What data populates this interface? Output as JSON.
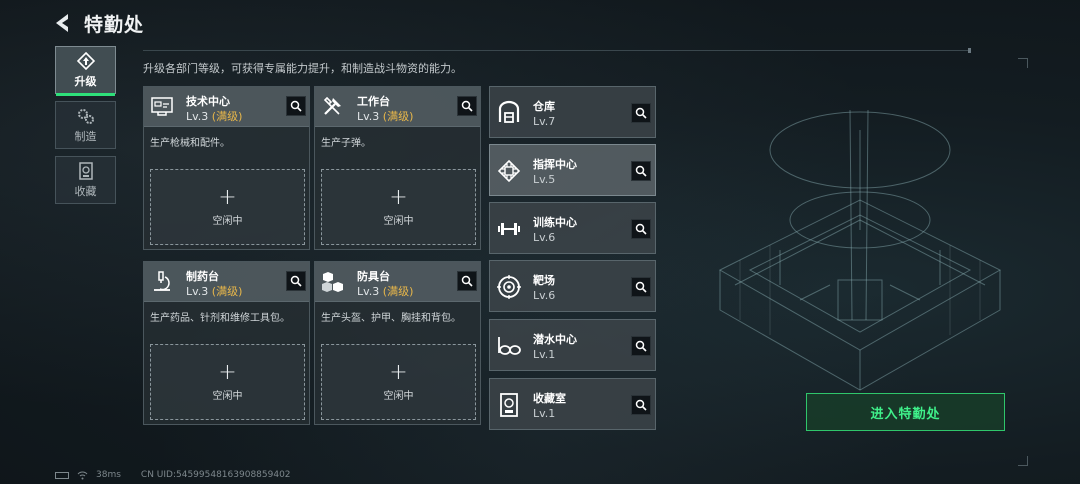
{
  "header": {
    "title": "特勤处"
  },
  "description": "升级各部门等级，可获得专属能力提升，和制造战斗物资的能力。",
  "side_tabs": [
    {
      "label": "升级",
      "icon": "upgrade-icon",
      "active": true
    },
    {
      "label": "制造",
      "icon": "gears-icon",
      "active": false
    },
    {
      "label": "收藏",
      "icon": "collection-icon",
      "active": false
    }
  ],
  "cards": [
    {
      "name": "技术中心",
      "level": "Lv.3",
      "max": "(满级)",
      "desc": "生产枪械和配件。",
      "plus": "+",
      "idle": "空闲中",
      "icon": "tech-center-icon"
    },
    {
      "name": "工作台",
      "level": "Lv.3",
      "max": "(满级)",
      "desc": "生产子弹。",
      "plus": "+",
      "idle": "空闲中",
      "icon": "tools-icon"
    },
    {
      "name": "制药台",
      "level": "Lv.3",
      "max": "(满级)",
      "desc": "生产药品、针剂和维修工具包。",
      "plus": "+",
      "idle": "空闲中",
      "icon": "microscope-icon"
    },
    {
      "name": "防具台",
      "level": "Lv.3",
      "max": "(满级)",
      "desc": "生产头盔、护甲、胸挂和背包。",
      "plus": "+",
      "idle": "空闲中",
      "icon": "armor-icon"
    }
  ],
  "rooms": [
    {
      "name": "仓库",
      "level": "Lv.7",
      "icon": "warehouse-icon"
    },
    {
      "name": "指挥中心",
      "level": "Lv.5",
      "icon": "chip-icon"
    },
    {
      "name": "训练中心",
      "level": "Lv.6",
      "icon": "dumbbell-icon"
    },
    {
      "name": "靶场",
      "level": "Lv.6",
      "icon": "target-icon"
    },
    {
      "name": "潜水中心",
      "level": "Lv.1",
      "icon": "diving-mask-icon"
    },
    {
      "name": "收藏室",
      "level": "Lv.1",
      "icon": "collection-room-icon"
    }
  ],
  "enter_button": "进入特勤处",
  "footer": {
    "ping": "38ms",
    "uid": "CN UID:5459954816390885940​2"
  },
  "colors": {
    "accent_green": "#2ee07a",
    "max_level": "#e8b74a"
  }
}
